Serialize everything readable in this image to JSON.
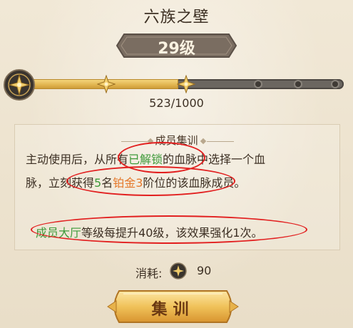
{
  "title": "六族之壁",
  "level": {
    "label": "29级"
  },
  "progress": {
    "current": 523,
    "max": 1000,
    "text": "523/1000",
    "fill_fraction": 0.48
  },
  "skill": {
    "title": "成员集训",
    "line1": {
      "a": "主动使用后，从所有",
      "b": "已解锁",
      "c": "的血脉中选择一个血"
    },
    "line2": {
      "a": "脉，立刻获得",
      "b": "5",
      "c": "名",
      "d": "铂金3",
      "e": "阶位的该血脉成员。"
    },
    "line3": {
      "a": "成员大厅",
      "b": "等级每提升40级，该效果强化1次。"
    }
  },
  "cost": {
    "label": "消耗:",
    "value": "90",
    "icon": "star-emblem-icon"
  },
  "button": {
    "label": "集训"
  },
  "colors": {
    "highlight_green": "#3e9a3a",
    "highlight_orange": "#e5782a",
    "progress_gold": "#e0b34d",
    "annotation_red": "#e21f1f"
  }
}
